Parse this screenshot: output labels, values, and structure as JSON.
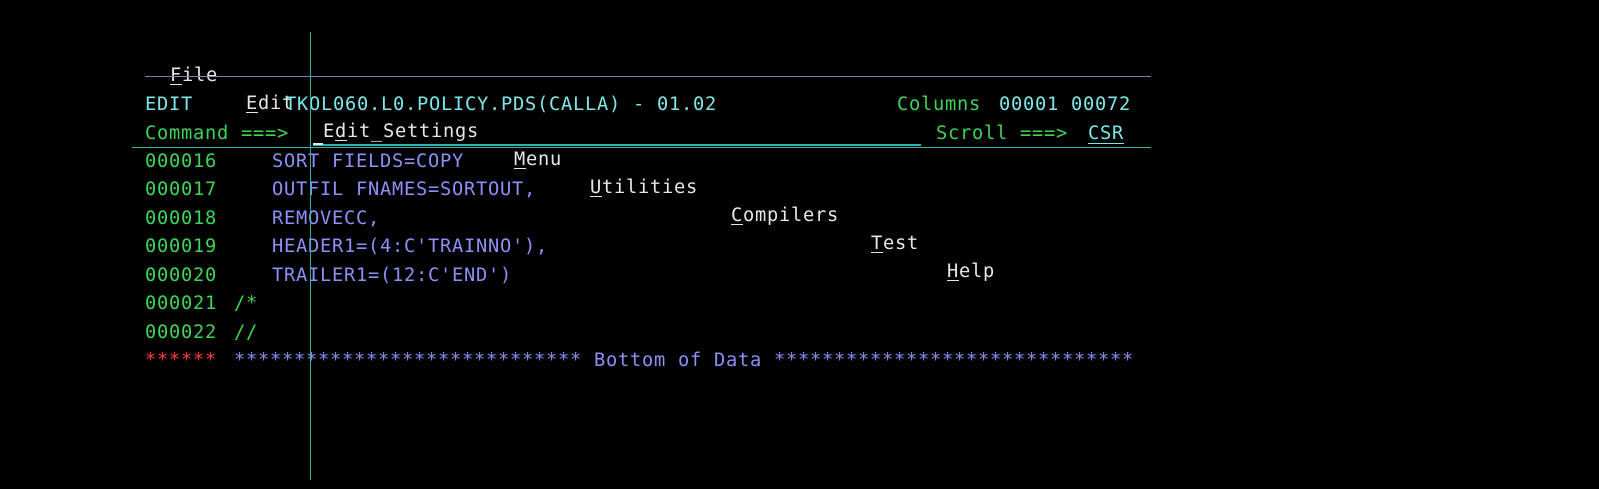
{
  "menu": [
    {
      "mnemonic": "F",
      "rest": "ile"
    },
    {
      "mnemonic": "E",
      "rest": "dit"
    },
    {
      "pre": "E",
      "mnemonic": "d",
      "rest": "it_Settings"
    },
    {
      "mnemonic": "M",
      "rest": "enu"
    },
    {
      "mnemonic": "U",
      "rest": "tilities"
    },
    {
      "mnemonic": "C",
      "rest": "ompilers"
    },
    {
      "mnemonic": "T",
      "rest": "est"
    },
    {
      "mnemonic": "H",
      "rest": "elp"
    }
  ],
  "header": {
    "mode": "EDIT",
    "dataset": "TKOL060.L0.POLICY.PDS(CALLA) - 01.02",
    "columns_label": "Columns",
    "columns_values": "00001 00072"
  },
  "command": {
    "label": "Command ===>",
    "value": "",
    "scroll_label": "Scroll ===>",
    "scroll_value": "CSR"
  },
  "lines": [
    {
      "num": "000016",
      "text": "SORT FIELDS=COPY"
    },
    {
      "num": "000017",
      "text": "OUTFIL FNAMES=SORTOUT,"
    },
    {
      "num": "000018",
      "text": "REMOVECC,"
    },
    {
      "num": "000019",
      "text": "HEADER1=(4:C'TRAINNO'),"
    },
    {
      "num": "000020",
      "text": "TRAILER1=(12:C'END')"
    },
    {
      "num": "000021",
      "text": "/*"
    },
    {
      "num": "000022",
      "text": "//"
    }
  ],
  "bottom": {
    "stars": "******",
    "text": "***************************** Bottom of Data ******************************"
  }
}
